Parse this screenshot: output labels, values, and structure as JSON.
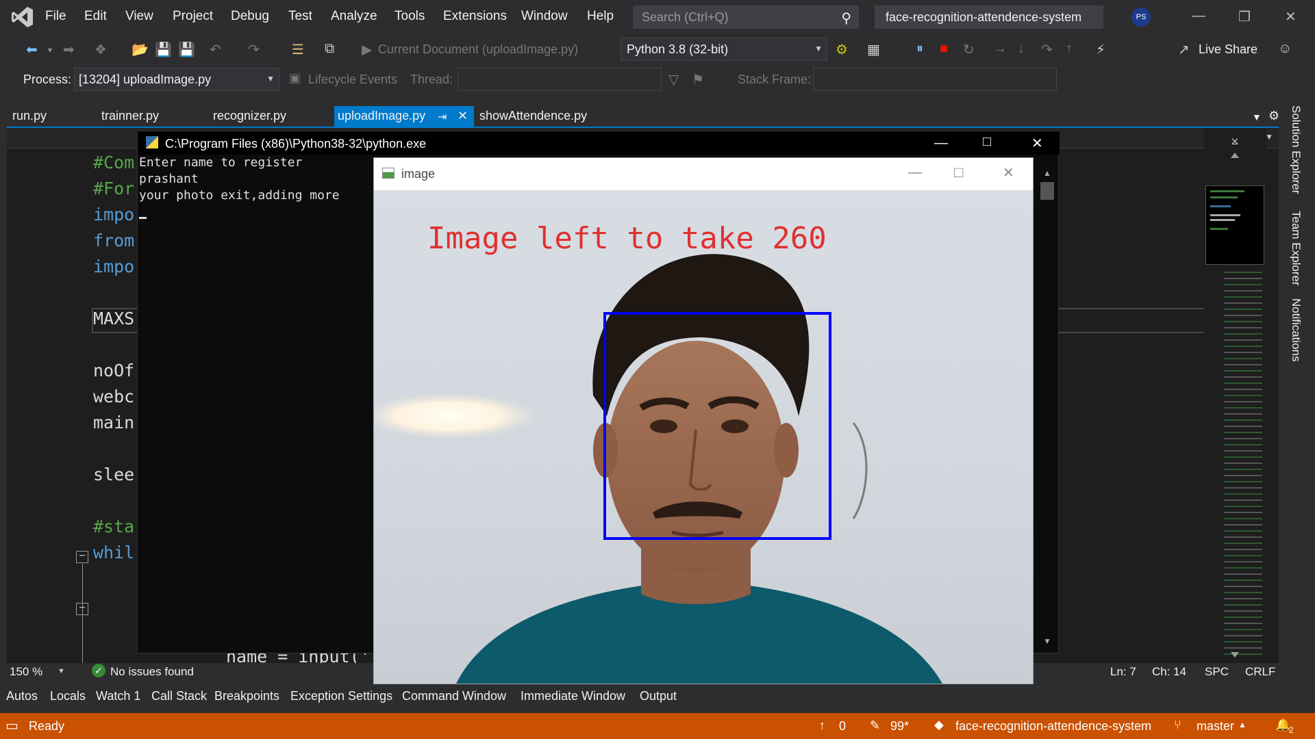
{
  "menu": {
    "items": [
      "File",
      "Edit",
      "View",
      "Project",
      "Debug",
      "Test",
      "Analyze",
      "Tools",
      "Extensions",
      "Window",
      "Help"
    ],
    "search_placeholder": "Search (Ctrl+Q)",
    "solution_name": "face-recognition-attendence-system",
    "avatar_initials": "PS"
  },
  "toolbar": {
    "current_document": "Current Document (uploadImage.py)",
    "python_env": "Python 3.8 (32-bit)",
    "live_share": "Live Share"
  },
  "debugbar": {
    "process_label": "Process:",
    "process_value": "[13204] uploadImage.py",
    "lifecycle": "Lifecycle Events",
    "thread_label": "Thread:",
    "stack_frame_label": "Stack Frame:"
  },
  "tabs": [
    {
      "label": "run.py"
    },
    {
      "label": "trainner.py"
    },
    {
      "label": "recognizer.py"
    },
    {
      "label": "uploadImage.py",
      "active": true
    },
    {
      "label": "showAttendence.py"
    }
  ],
  "code_lines": [
    {
      "text": "#Com",
      "kind": "comment"
    },
    {
      "text": "#For",
      "kind": "comment"
    },
    {
      "text": "impo",
      "kind": "kw"
    },
    {
      "text": "from",
      "kind": "kw"
    },
    {
      "text": "impo",
      "kind": "kw"
    },
    {
      "text": "MAXS",
      "kind": "id"
    },
    {
      "text": "noOf",
      "kind": "id"
    },
    {
      "text": "webc",
      "kind": "id"
    },
    {
      "text": "main",
      "kind": "id"
    },
    {
      "text": "slee",
      "kind": "id"
    },
    {
      "text": "#sta",
      "kind": "comment"
    },
    {
      "text": "whil",
      "kind": "kw"
    },
    {
      "text": "name = input('",
      "kind": "id"
    }
  ],
  "side_rail": [
    "Solution Explorer",
    "Team Explorer",
    "Notifications"
  ],
  "editor_status": {
    "zoom": "150 %",
    "issues": "No issues found",
    "line": "Ln: 7",
    "col": "Ch: 14",
    "spc": "SPC",
    "crlf": "CRLF"
  },
  "tool_tabs": [
    "Autos",
    "Locals",
    "Watch 1",
    "Call Stack",
    "Breakpoints",
    "Exception Settings",
    "Command Window",
    "Immediate Window",
    "Output"
  ],
  "statusbar": {
    "ready": "Ready",
    "up_count": "0",
    "edits": "99*",
    "repo": "face-recognition-attendence-system",
    "branch": "master",
    "notifications": "2"
  },
  "console": {
    "title": "C:\\Program Files (x86)\\Python38-32\\python.exe",
    "lines": [
      "Enter name to register",
      "prashant",
      "your photo exit,adding more"
    ]
  },
  "image_window": {
    "title": "image",
    "overlay_text": "Image left to take 260"
  },
  "colors": {
    "accent": "#007acc",
    "statusbar": "#ca5100",
    "face_box": "#0000ff",
    "overlay_text": "#e03030"
  }
}
